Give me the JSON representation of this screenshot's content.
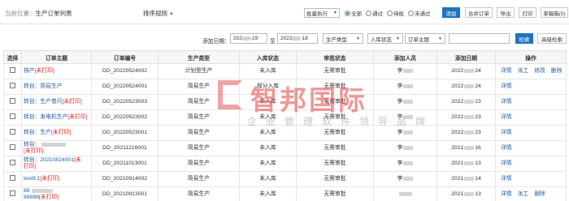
{
  "breadcrumb": {
    "label": "当前位置：",
    "current": "生产订单列表"
  },
  "rule_menu": {
    "label": "排序规则"
  },
  "toolbar": {
    "batch_select": "批量执行",
    "radios": [
      {
        "label": "全部",
        "checked": true
      },
      {
        "label": "通过",
        "checked": false
      },
      {
        "label": "待批",
        "checked": false
      },
      {
        "label": "未通过",
        "checked": false
      }
    ],
    "buttons": [
      "添加",
      "合并订单",
      "导出",
      "打印",
      "草稿箱(0)"
    ]
  },
  "filters": {
    "date_label": "添加日期：",
    "date_from": "202",
    "date_from_tail": "-19",
    "to_label": "至",
    "date_to": "2022",
    "date_to_tail": "-18",
    "production_type": "生产类型",
    "stock_status": "入库状态",
    "order_subject": "订单主题",
    "search_placeholder": "",
    "search_button": "检索",
    "advanced_button": "高级检索"
  },
  "table": {
    "columns": [
      "选择",
      "订单主题",
      "订单编号",
      "生产类型",
      "入库状态",
      "审批状态",
      "添加人员",
      "添加日期",
      "操作"
    ],
    "rows": [
      {
        "subject": "排产",
        "subject_tag": "[未打印]",
        "subject_line2": "",
        "order_no": "DD_20220524002",
        "type": "计划型生产",
        "stock": "未入库",
        "approval": "无需审批",
        "person": "李",
        "date_head": "2022",
        "date_tail": "24",
        "ops": [
          "详情",
          "派工",
          "修改",
          "删除"
        ]
      },
      {
        "subject": "转自：简易生产",
        "subject_tag": "",
        "subject_line2": "",
        "order_no": "DD_20220524001",
        "type": "简易生产",
        "stock": "部分入库",
        "approval": "无需审批",
        "person": "李",
        "date_head": "2022",
        "date_tail": "24",
        "ops": [
          "详情"
        ]
      },
      {
        "subject": "转自：生产卷尺",
        "subject_tag": "[未打印]",
        "subject_line2": "",
        "order_no": "DD_20220523003",
        "type": "简易生产",
        "stock": "未入库",
        "approval": "无需审批",
        "person": "李",
        "date_head": "2022",
        "date_tail": "23",
        "ops": [
          "详情"
        ]
      },
      {
        "subject": "转自：发电机生产",
        "subject_tag": "[未打印]",
        "subject_line2": "",
        "order_no": "DD_20220523002",
        "type": "简易生产",
        "stock": "未入库",
        "approval": "无需审批",
        "person": "李",
        "date_head": "2022",
        "date_tail": "23",
        "ops": [
          "详情"
        ]
      },
      {
        "subject": "转自：生产",
        "subject_tag": "[未打印]",
        "subject_line2": "",
        "order_no": "DD_20220523001",
        "type": "简易生产",
        "stock": "未入库",
        "approval": "无需审批",
        "person": "李",
        "date_head": "2022",
        "date_tail": "23",
        "ops": [
          "详情"
        ]
      },
      {
        "subject": "转自：",
        "subject_tag": "[未打印]",
        "subject_line2": "",
        "order_no": "DD_20211216001",
        "type": "简易生产",
        "stock": "未入库",
        "approval": "无需审批",
        "person": "李",
        "date_head": "2021",
        "date_tail": "16",
        "ops": [
          "详情"
        ]
      },
      {
        "subject": "转自：20210824001",
        "subject_tag": "[未",
        "subject_line2": "打印]",
        "order_no": "DD_20211013001",
        "type": "简易生产",
        "stock": "未入库",
        "approval": "无需审批",
        "person": "李",
        "date_head": "2021",
        "date_tail": "13",
        "ops": [
          "详情"
        ]
      },
      {
        "subject": "test9.1",
        "subject_tag": "[未打印]",
        "subject_line2": "",
        "order_no": "DD_20210914002",
        "type": "简易生产",
        "stock": "未入库",
        "approval": "无需审批",
        "person": "李",
        "date_head": "2021",
        "date_tail": "14",
        "ops": [
          "详情"
        ]
      },
      {
        "subject": "88",
        "subject_tag": "[未打印]",
        "subject_line2": "88888",
        "order_no": "DD_20210913001",
        "type": "简易生产",
        "stock": "未入库",
        "approval": "无需审批",
        "person": "",
        "date_head": "2021",
        "date_tail": "13",
        "ops": [
          "详情",
          "派工",
          "删除"
        ]
      }
    ]
  },
  "watermark": {
    "main": "智邦国际",
    "sub": "企业管理软件领导品牌"
  },
  "colors": {
    "primary": "#1e73be",
    "link": "#1e5ea8",
    "tag_red": "#dd2222",
    "watermark_red": "#e14545"
  }
}
